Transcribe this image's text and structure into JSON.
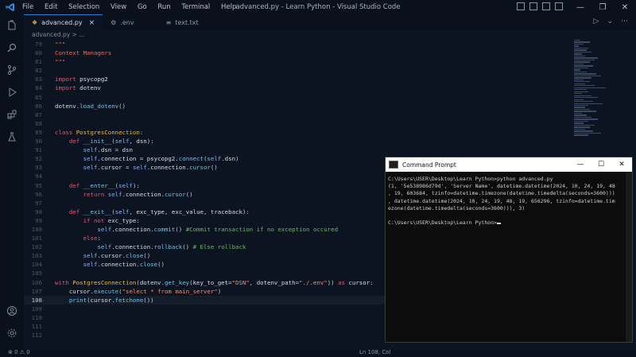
{
  "window": {
    "title": "advanced.py - Learn Python - Visual Studio Code",
    "menu": [
      "File",
      "Edit",
      "Selection",
      "View",
      "Go",
      "Run",
      "Terminal",
      "Help"
    ]
  },
  "tabs": [
    {
      "label": "advanced.py",
      "icon": "python-file-icon",
      "active": true,
      "close": "×"
    },
    {
      "label": ".env",
      "icon": "gear-icon",
      "active": false
    },
    {
      "label": "text.txt",
      "icon": "text-file-icon",
      "active": false
    }
  ],
  "breadcrumb": "advanced.py > ...",
  "editor_actions": [
    "▷",
    "⌄",
    "⋯"
  ],
  "code_lines": [
    {
      "n": "79",
      "html": "<span class='cmt'>\"\"\"</span>"
    },
    {
      "n": "80",
      "html": "<span class='cmt'>Context Managers</span>"
    },
    {
      "n": "81",
      "html": "<span class='cmt'>\"\"\"</span>"
    },
    {
      "n": "82",
      "html": ""
    },
    {
      "n": "83",
      "html": "<span class='kw'>import</span> <span class='id'>psycopg2</span>"
    },
    {
      "n": "84",
      "html": "<span class='kw'>import</span> <span class='id'>dotenv</span>"
    },
    {
      "n": "85",
      "html": ""
    },
    {
      "n": "86",
      "html": "<span class='id'>dotenv</span>.<span class='fn'>load_dotenv</span>()"
    },
    {
      "n": "87",
      "html": ""
    },
    {
      "n": "88",
      "html": ""
    },
    {
      "n": "89",
      "html": "<span class='kw'>class</span> <span class='cls'>PostgresConnection</span>:"
    },
    {
      "n": "90",
      "html": "    <span class='kw'>def</span> <span class='fn'>__init__</span>(<span class='self'>self</span>, <span class='id'>dsn</span>):"
    },
    {
      "n": "91",
      "html": "        <span class='self'>self</span>.<span class='id'>dsn</span> = <span class='id'>dsn</span>"
    },
    {
      "n": "92",
      "html": "        <span class='self'>self</span>.<span class='id'>connection</span> = <span class='id'>psycopg2</span>.<span class='fn'>connect</span>(<span class='self'>self</span>.<span class='id'>dsn</span>)"
    },
    {
      "n": "93",
      "html": "        <span class='self'>self</span>.<span class='id'>cursor</span> = <span class='self'>self</span>.<span class='id'>connection</span>.<span class='fn'>cursor</span>()"
    },
    {
      "n": "94",
      "html": ""
    },
    {
      "n": "95",
      "html": "    <span class='kw'>def</span> <span class='fn'>__enter__</span>(<span class='self'>self</span>):"
    },
    {
      "n": "96",
      "html": "        <span class='kw'>return</span> <span class='self'>self</span>.<span class='id'>connection</span>.<span class='fn'>cursor</span>()"
    },
    {
      "n": "97",
      "html": ""
    },
    {
      "n": "98",
      "html": "    <span class='kw'>def</span> <span class='fn'>__exit__</span>(<span class='self'>self</span>, <span class='id'>exc_type</span>, <span class='id'>exc_value</span>, <span class='id'>traceback</span>):"
    },
    {
      "n": "99",
      "html": "        <span class='kw'>if</span> <span class='kw'>not</span> <span class='id'>exc_type</span>:"
    },
    {
      "n": "100",
      "html": "            <span class='self'>self</span>.<span class='id'>connection</span>.<span class='fn'>commit</span>() <span class='cm'>#Commit transaction if no exception occured</span>"
    },
    {
      "n": "101",
      "html": "        <span class='kw'>else</span>:"
    },
    {
      "n": "102",
      "html": "            <span class='self'>self</span>.<span class='id'>connection</span>.<span class='fn'>rollback</span>() <span class='cm'># Else rollback</span>"
    },
    {
      "n": "103",
      "html": "        <span class='self'>self</span>.<span class='id'>cursor</span>.<span class='fn'>close</span>()"
    },
    {
      "n": "104",
      "html": "        <span class='self'>self</span>.<span class='id'>connection</span>.<span class='fn'>close</span>()"
    },
    {
      "n": "105",
      "html": ""
    },
    {
      "n": "106",
      "html": "<span class='kw'>with</span> <span class='cls'>PostgresConnection</span>(<span class='id'>dotenv</span>.<span class='fn'>get_key</span>(<span class='id'>key_to_get</span>=<span class='str'>\"DSN\"</span>, <span class='id'>dotenv_path</span>=<span class='str'>\"./.env\"</span>)) <span class='kw'>as</span> <span class='id'>cursor</span>:"
    },
    {
      "n": "107",
      "html": "    <span class='id'>cursor</span>.<span class='fn'>execute</span>(<span class='str'>\"select * from main_server\"</span>)"
    },
    {
      "n": "108",
      "html": "    <span class='fn'>print</span>(<span class='id'>cursor</span>.<span class='fn'>fetchone</span>())",
      "current": true
    },
    {
      "n": "109",
      "html": ""
    },
    {
      "n": "110",
      "html": ""
    },
    {
      "n": "111",
      "html": ""
    },
    {
      "n": "112",
      "html": ""
    }
  ],
  "cmd": {
    "title": "Command Prompt",
    "lines": [
      "C:\\Users\\USER\\Desktop\\Learn Python>python advanced.py",
      "(1, '5e538986d79d', 'Server Name', datetime.datetime(2024, 10, 24, 19, 48",
      ", 19, 603684, tzinfo=datetime.timezone(datetime.timedelta(seconds=3600)))",
      ", datetime.datetime(2024, 10, 24, 19, 48, 19, 656296, tzinfo=datetime.tim",
      "ezone(datetime.timedelta(seconds=3600))), 3)",
      "",
      "C:\\Users\\USER\\Desktop\\Learn Python>"
    ]
  },
  "status": {
    "problems": "⊗ 0 ⚠ 0",
    "position": "Ln 108, Col"
  }
}
